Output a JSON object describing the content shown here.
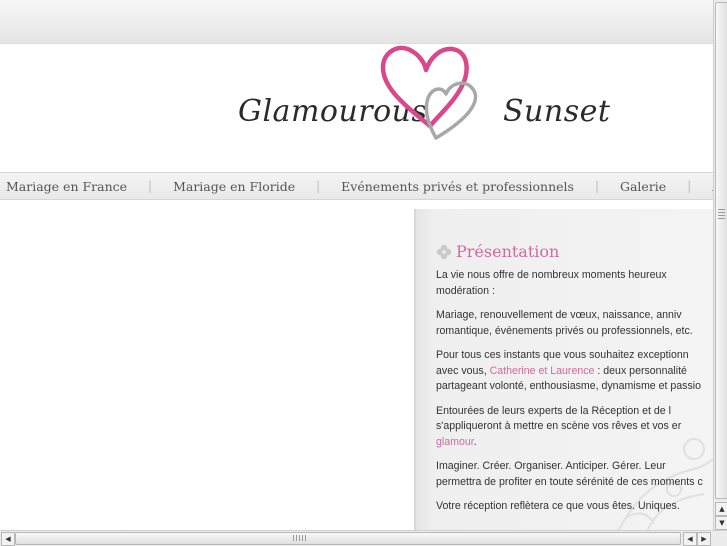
{
  "logo": {
    "word_left": "Glamourous",
    "word_right": "Sunset",
    "heart_primary_color": "#d9488b",
    "heart_secondary_color": "#9a9a9a",
    "icon": "double-heart-icon"
  },
  "nav": {
    "items": [
      {
        "label": "Mariage en France"
      },
      {
        "label": "Mariage en Floride"
      },
      {
        "label": "Evénements privés et professionnels"
      },
      {
        "label": "Galerie"
      },
      {
        "label": "Actualités"
      }
    ],
    "separator": "|"
  },
  "presentation": {
    "title": "Présentation",
    "title_icon": "flower-icon",
    "accent_color": "#d26a9b",
    "paragraphs": [
      {
        "lines": [
          "La vie nous offre de nombreux moments heureux",
          "modération :"
        ]
      },
      {
        "lines": [
          "Mariage, renouvellement de vœux, naissance, anniv",
          "romantique, événements privés ou professionnels, etc."
        ]
      },
      {
        "p3_line1": "Pour tous ces instants que vous souhaitez exceptionn",
        "p3_line2_pre": "avec vous, ",
        "p3_line2_link": "Catherine et Laurence",
        "p3_line2_post": " : deux personnalité",
        "p3_line3": "partageant volonté, enthousiasme, dynamisme et passio"
      },
      {
        "p4_line1": "Entourées de leurs experts de la Réception et de l",
        "p4_line2": "s'appliqueront à mettre en scène vos rêves et vos er",
        "p4_line3_link": "glamour",
        "p4_line3_post": "."
      },
      {
        "lines": [
          "Imaginer. Créer. Organiser. Anticiper. Gérer. Leur",
          "permettra de profiter en toute sérénité de ces moments c"
        ]
      },
      {
        "lines": [
          "Votre réception reflètera ce que vous êtes. Uniques."
        ]
      }
    ]
  },
  "scrollbars": {
    "up_arrow": "▲",
    "down_arrow": "▼",
    "left_arrow": "◀",
    "right_arrow": "▶"
  }
}
